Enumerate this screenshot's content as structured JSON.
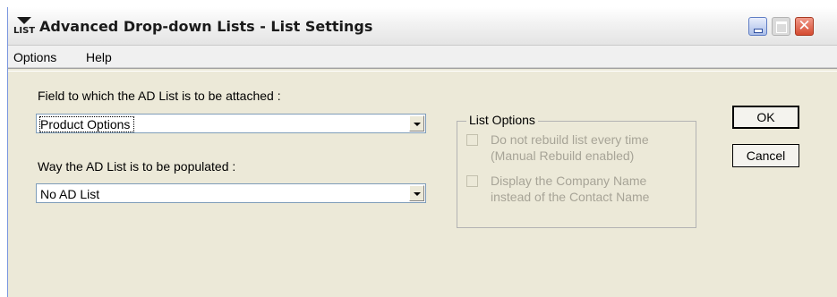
{
  "window": {
    "title": "Advanced Drop-down Lists - List Settings",
    "icon_label": "LIST",
    "controls": {
      "minimize": "minimize",
      "maximize": "maximize",
      "close": "✕"
    }
  },
  "menu": {
    "items": [
      "Options",
      "Help"
    ]
  },
  "form": {
    "field_label": "Field to which the AD List is to be attached :",
    "field_value": "Product Options",
    "populate_label": "Way the AD List is to be populated :",
    "populate_value": "No AD List"
  },
  "list_options": {
    "title": "List Options",
    "option1": {
      "line1": "Do not rebuild list every time",
      "line2": "(Manual Rebuild enabled)",
      "checked": false,
      "enabled": false
    },
    "option2": {
      "line1": "Display the Company Name",
      "line2": "instead of the Contact Name",
      "checked": false,
      "enabled": false
    }
  },
  "buttons": {
    "ok": "OK",
    "cancel": "Cancel"
  }
}
